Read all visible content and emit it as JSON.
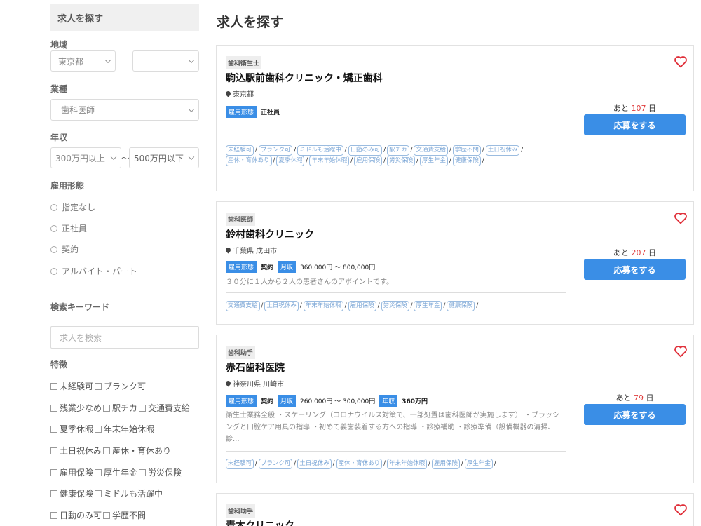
{
  "sidebar": {
    "title": "求人を探す",
    "region_label": "地域",
    "region_select": "東京都",
    "region_sub_select": "",
    "job_type_label": "業種",
    "job_type_select": "歯科医師",
    "salary_label": "年収",
    "salary_min": "300万円以上",
    "salary_sep": "〜",
    "salary_max": "500万円以下",
    "employment_label": "雇用形態",
    "employment_options": [
      "指定なし",
      "正社員",
      "契約",
      "アルバイト・パート"
    ],
    "keyword_label": "検索キーワード",
    "keyword_placeholder": "求人を検索",
    "features_label": "特徴",
    "feature_rows": [
      [
        "未経験可",
        "ブランク可"
      ],
      [
        "残業少なめ",
        "駅チカ",
        "交通費支給"
      ],
      [
        "夏季休暇",
        "年末年始休暇"
      ],
      [
        "土日祝休み",
        "産休・育休あり"
      ],
      [
        "雇用保険",
        "厚生年金",
        "労災保険"
      ],
      [
        "健康保険",
        "ミドルも活躍中"
      ],
      [
        "日動のみ可",
        "学歴不問"
      ]
    ]
  },
  "main": {
    "title": "求人を探す",
    "apply_label": "応募をする",
    "remain_prefix": "あと",
    "remain_suffix": "日",
    "jobs": [
      {
        "category": "歯科衛生士",
        "clinic": "駒込駅前歯科クリニック・矯正歯科",
        "location": "東京都",
        "employment_tag": "雇用形態",
        "employment": "正社員",
        "days_left": "107",
        "features": [
          "未経験可",
          "ブランク可",
          "ミドルも活躍中",
          "日動のみ可",
          "駅チカ",
          "交通費支給",
          "学歴不問",
          "土日祝休み",
          "産休・育休あり",
          "夏季休暇",
          "年末年始休暇",
          "雇用保険",
          "労災保険",
          "厚生年金",
          "健康保険"
        ]
      },
      {
        "category": "歯科医師",
        "clinic": "鈴村歯科クリニック",
        "location": "千葉県 成田市",
        "employment_tag": "雇用形態",
        "employment": "契約",
        "monthly_tag": "月収",
        "monthly": "360,000円 〜 800,000円",
        "description": "３０分に１人から２人の患者さんのアポイントです。",
        "days_left": "207",
        "features": [
          "交通費支給",
          "土日祝休み",
          "年末年始休暇",
          "雇用保険",
          "労災保険",
          "厚生年金",
          "健康保険"
        ]
      },
      {
        "category": "歯科助手",
        "clinic": "赤石歯科医院",
        "location": "神奈川県 川崎市",
        "employment_tag": "雇用形態",
        "employment": "契約",
        "monthly_tag": "月収",
        "monthly": "260,000円 〜 300,000円",
        "annual_tag": "年収",
        "annual": "360万円",
        "description": "衛生士業務全般 ・スケーリング（コロナウイルス対策で、一部処置は歯科医師が実施します） ・ブラッシングと口腔ケア用具の指導 ・初めて義歯装着する方への指導 ・診療補助 ・診療準備（設備機器の清掃、診...",
        "days_left": "79",
        "features": [
          "未経験可",
          "ブランク可",
          "土日祝休み",
          "産休・育休あり",
          "年末年始休暇",
          "雇用保険",
          "厚生年金"
        ]
      },
      {
        "category": "歯科助手",
        "clinic": "青木クリニック"
      }
    ]
  },
  "colors": {
    "accent": "#3a8ee6",
    "days_left": "#e04040",
    "heart": "#e0303a"
  }
}
